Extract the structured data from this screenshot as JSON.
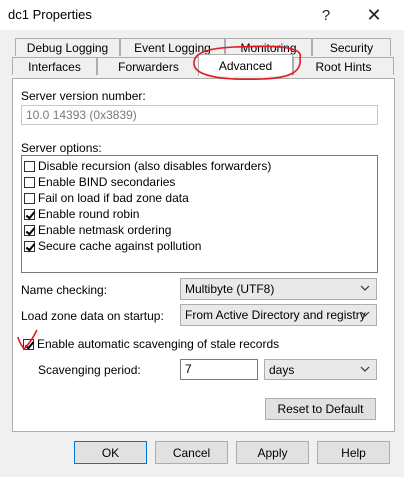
{
  "window": {
    "title": "dc1 Properties",
    "help_glyph": "?",
    "close_glyph": "✕"
  },
  "tabs": {
    "row_back": [
      "Debug Logging",
      "Event Logging",
      "Monitoring",
      "Security"
    ],
    "row_front": [
      "Interfaces",
      "Forwarders",
      "Advanced",
      "Root Hints"
    ],
    "active": "Advanced"
  },
  "panel": {
    "version_label": "Server version number:",
    "version_value": "10.0 14393 (0x3839)",
    "options_label": "Server options:",
    "options": [
      {
        "label": "Disable recursion (also disables forwarders)",
        "checked": false
      },
      {
        "label": "Enable BIND secondaries",
        "checked": false
      },
      {
        "label": "Fail on load if bad zone data",
        "checked": false
      },
      {
        "label": "Enable round robin",
        "checked": true
      },
      {
        "label": "Enable netmask ordering",
        "checked": true
      },
      {
        "label": "Secure cache against pollution",
        "checked": true
      }
    ],
    "name_checking_label": "Name checking:",
    "name_checking_value": "Multibyte (UTF8)",
    "load_zone_label": "Load zone data on startup:",
    "load_zone_value": "From Active Directory and registry",
    "scavenging_label": "Enable automatic scavenging of stale records",
    "scavenging_checked": true,
    "period_label": "Scavenging period:",
    "period_value": "7",
    "period_unit": "days",
    "reset_label": "Reset to Default"
  },
  "footer": {
    "ok": "OK",
    "cancel": "Cancel",
    "apply": "Apply",
    "help": "Help"
  },
  "colors": {
    "annotation_red": "#e11b22",
    "default_button_border": "#0078d7"
  }
}
